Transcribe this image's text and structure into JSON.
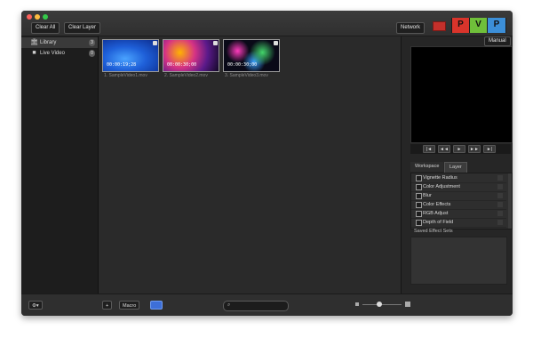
{
  "toolbar": {
    "clear_all_label": "Clear All",
    "clear_layer_label": "Clear Layer",
    "network_label": "Network"
  },
  "pvp": {
    "p": "P",
    "v": "V",
    "p2": "P"
  },
  "sidebar": {
    "items": [
      {
        "label": "Library",
        "count": "3",
        "icon": "library-icon"
      },
      {
        "label": "Live Video",
        "count": "0",
        "icon": "video-camera-icon"
      }
    ]
  },
  "media": {
    "items": [
      {
        "timecode": "00:00:19;28",
        "caption": "1. SampleVideo1.mov"
      },
      {
        "timecode": "00:00:30;00",
        "caption": "2. SampleVideo2.mov"
      },
      {
        "timecode": "00:00:30;00",
        "caption": "3. SampleVideo3.mov"
      }
    ]
  },
  "preview": {
    "manual_label": "Manual"
  },
  "transport": {
    "b1": "◄◄",
    "b2": "◄",
    "b3": "►",
    "b4": "►►",
    "b5": "►|",
    "b0": "|◄"
  },
  "tabs": {
    "workspace": "Workspace",
    "layer": "Layer"
  },
  "effects": [
    "Vignette Radius",
    "Color Adjustment",
    "Blur",
    "Color Effects",
    "RGB Adjust",
    "Depth of Field"
  ],
  "saved_effect_sets_label": "Saved Effect Sets",
  "bottom": {
    "add_label": "+",
    "macro_label": "Macro"
  }
}
